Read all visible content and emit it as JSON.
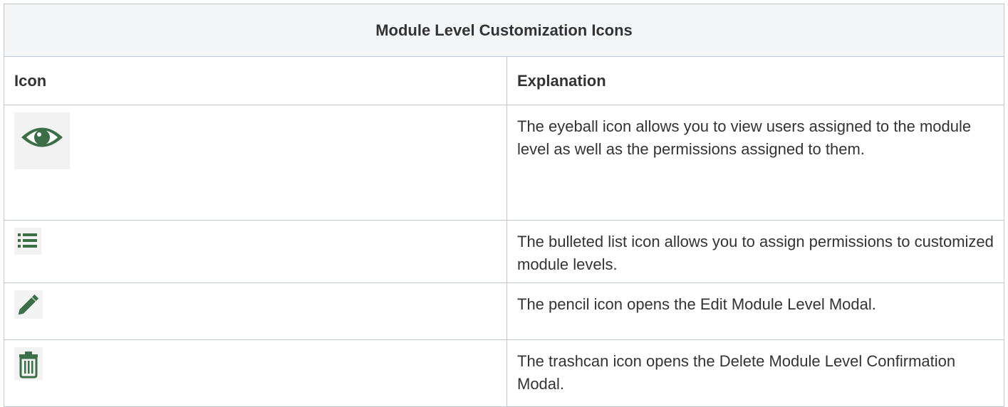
{
  "table": {
    "title": "Module Level Customization Icons",
    "headers": {
      "icon": "Icon",
      "explanation": "Explanation"
    },
    "rows": [
      {
        "icon": "eye-icon",
        "explanation": "The eyeball icon allows you to view users assigned to the module level as well as the permissions assigned to them."
      },
      {
        "icon": "bulleted-list-icon",
        "explanation": "The bulleted list icon allows you to assign permissions to customized module levels."
      },
      {
        "icon": "pencil-icon",
        "explanation": "The pencil icon opens the Edit Module Level Modal."
      },
      {
        "icon": "trashcan-icon",
        "explanation": "The trashcan icon opens the Delete Module Level Confirmation Modal."
      }
    ]
  },
  "colors": {
    "icon_green": "#3c6e48",
    "border": "#c1c7d0",
    "title_background": "#f4f5f7",
    "text": "#333333"
  }
}
